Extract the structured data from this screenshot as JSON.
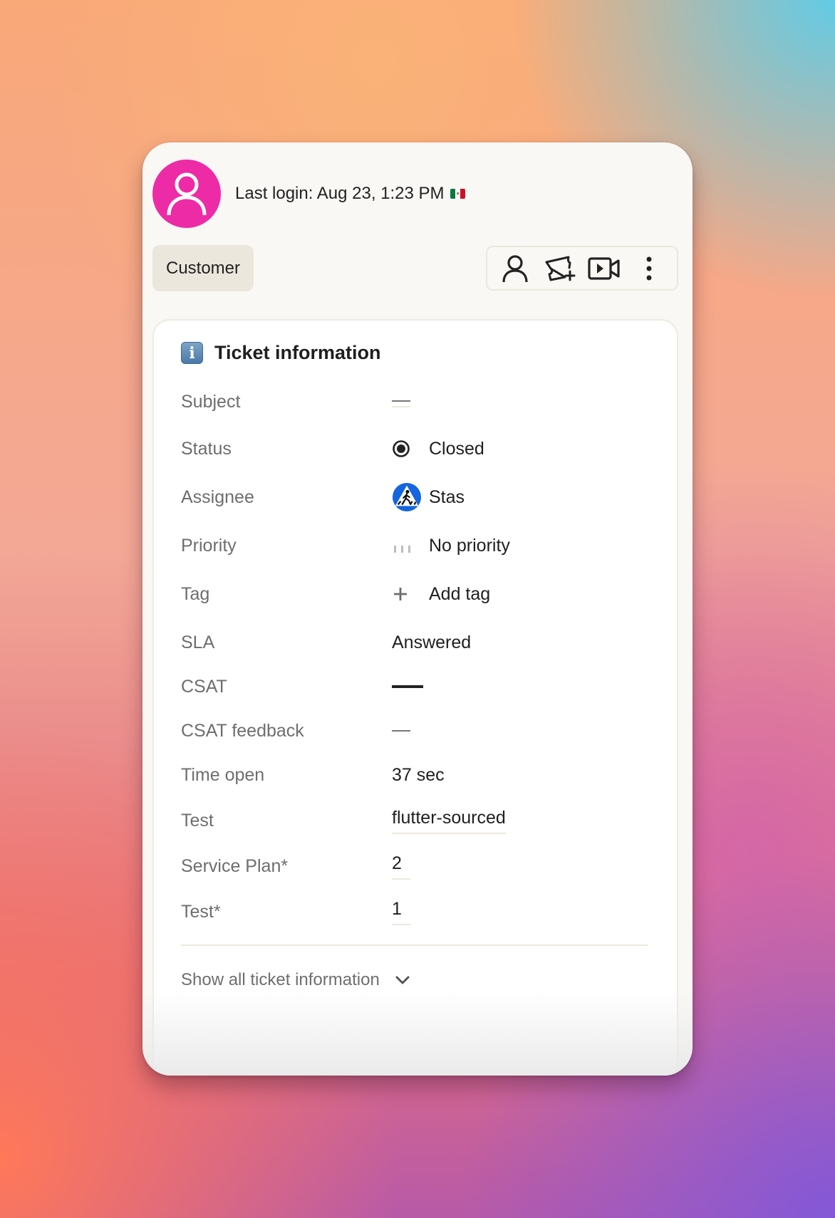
{
  "header": {
    "avatar_icon": "user-icon",
    "avatar_color": "#ee2ba6",
    "last_login": "Last login: Aug 23, 1:23 PM",
    "flag_icon": "mexico-flag-icon"
  },
  "role_badge": {
    "label": "Customer"
  },
  "actions": [
    {
      "name": "profile",
      "icon": "user-icon"
    },
    {
      "name": "new-ticket",
      "icon": "ticket-plus-icon"
    },
    {
      "name": "video-call",
      "icon": "video-camera-icon"
    },
    {
      "name": "more",
      "icon": "more-vertical-icon"
    }
  ],
  "ticket_info": {
    "title": "Ticket information",
    "title_icon": "information-icon",
    "fields": {
      "subject": {
        "label": "Subject",
        "value": "—"
      },
      "status": {
        "label": "Status",
        "value": "Closed",
        "icon": "radio-filled-icon"
      },
      "assignee": {
        "label": "Assignee",
        "value": "Stas",
        "icon": "pedestrian-crossing-avatar"
      },
      "priority": {
        "label": "Priority",
        "value": "No priority",
        "icon": "priority-bars-icon"
      },
      "tag": {
        "label": "Tag",
        "value": "Add tag",
        "icon": "plus-icon"
      },
      "sla": {
        "label": "SLA",
        "value": "Answered",
        "color": "#118a14"
      },
      "csat": {
        "label": "CSAT",
        "value": "—"
      },
      "csat_feedback": {
        "label": "CSAT feedback",
        "value": "—"
      },
      "time_open": {
        "label": "Time open",
        "value": "37 sec"
      },
      "test": {
        "label": "Test",
        "value": "flutter-sourced"
      },
      "service_plan": {
        "label": "Service Plan*",
        "value": "2"
      },
      "test_required": {
        "label": "Test*",
        "value": "1"
      }
    },
    "show_all_label": "Show all ticket information"
  }
}
